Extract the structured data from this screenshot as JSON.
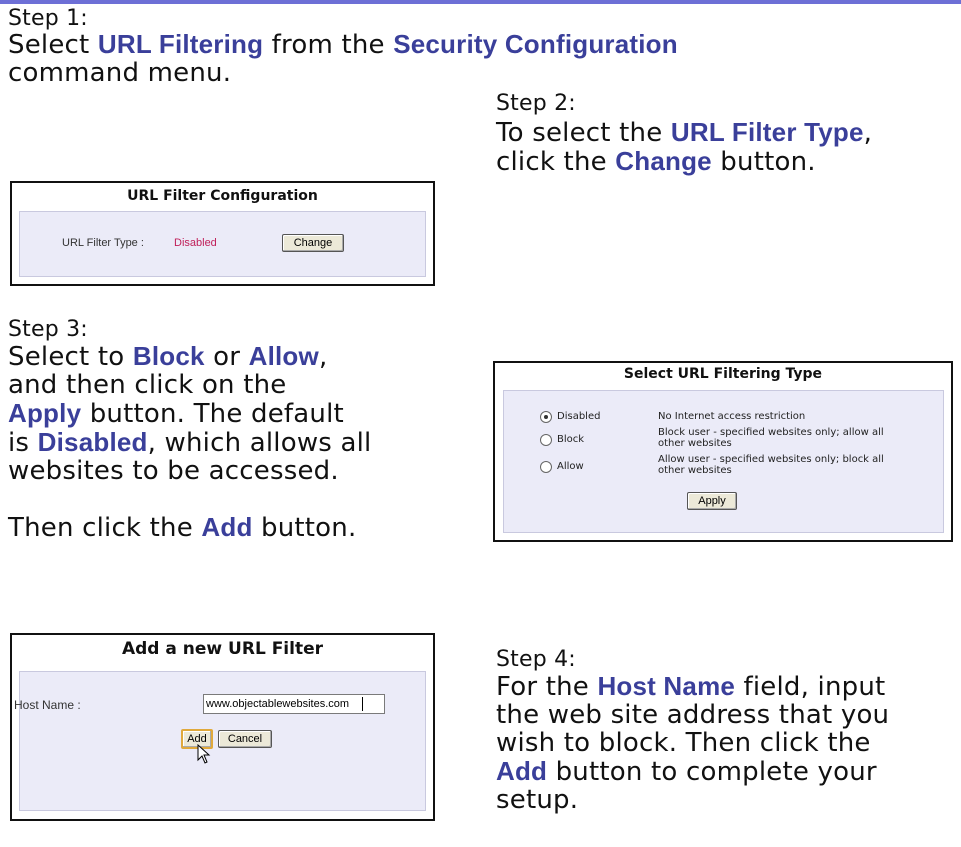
{
  "step1": {
    "label": "Step 1:",
    "line1_pre": "Select ",
    "kw_url_filtering": "URL Filtering",
    "line1_mid": " from the ",
    "kw_security_configuration": "Security Configuration",
    "line2": "command menu."
  },
  "url_filter_config": {
    "title": "URL Filter Configuration",
    "type_label": "URL Filter Type :",
    "type_value": "Disabled",
    "change_button": "Change"
  },
  "step2": {
    "label": "Step 2:",
    "line1_pre": "To select the ",
    "kw_url_filter_type": "URL Filter Type",
    "line1_post": ",",
    "line2_pre": "click the ",
    "kw_change": "Change",
    "line2_post": " button."
  },
  "step3": {
    "label": "Step 3:",
    "line1_pre": "Select to ",
    "kw_block": "Block",
    "line1_mid": " or ",
    "kw_allow": "Allow",
    "line1_post": ",",
    "line2": "and then click on the",
    "kw_apply": "Apply",
    "line3_post": " button. The default",
    "line4_pre": "is ",
    "kw_disabled": "Disabled",
    "line4_post": ", which allows all",
    "line5": "websites to be accessed.",
    "line6_pre": "Then click the ",
    "kw_add": "Add",
    "line6_post": " button."
  },
  "select_type_panel": {
    "title": "Select URL Filtering Type",
    "options": [
      {
        "label": "Disabled",
        "description_line1": "No Internet access restriction",
        "description_line2": "",
        "selected": true
      },
      {
        "label": "Block",
        "description_line1": "Block user - specified websites only; allow all",
        "description_line2": "other websites",
        "selected": false
      },
      {
        "label": "Allow",
        "description_line1": "Allow user - specified websites only; block all",
        "description_line2": "other websites",
        "selected": false
      }
    ],
    "apply_button": "Apply"
  },
  "add_filter_panel": {
    "title": "Add a new URL Filter",
    "host_label": "Host Name :",
    "host_value": "www.objectablewebsites.com",
    "add_button": "Add",
    "cancel_button": "Cancel"
  },
  "step4": {
    "label": "Step 4:",
    "line1_pre": "For the ",
    "kw_host_name": "Host Name",
    "line1_post": " field, input",
    "line2": "the web site address that you",
    "line3": "wish to block. Then click the",
    "kw_add": "Add",
    "line4_post": " button to complete your",
    "line5": "setup."
  },
  "colors": {
    "accent_bar": "#6d6fd6",
    "keyword": "#3a3f9a",
    "panel_bg": "#ebebf8",
    "disabled_value": "#c0205a"
  }
}
